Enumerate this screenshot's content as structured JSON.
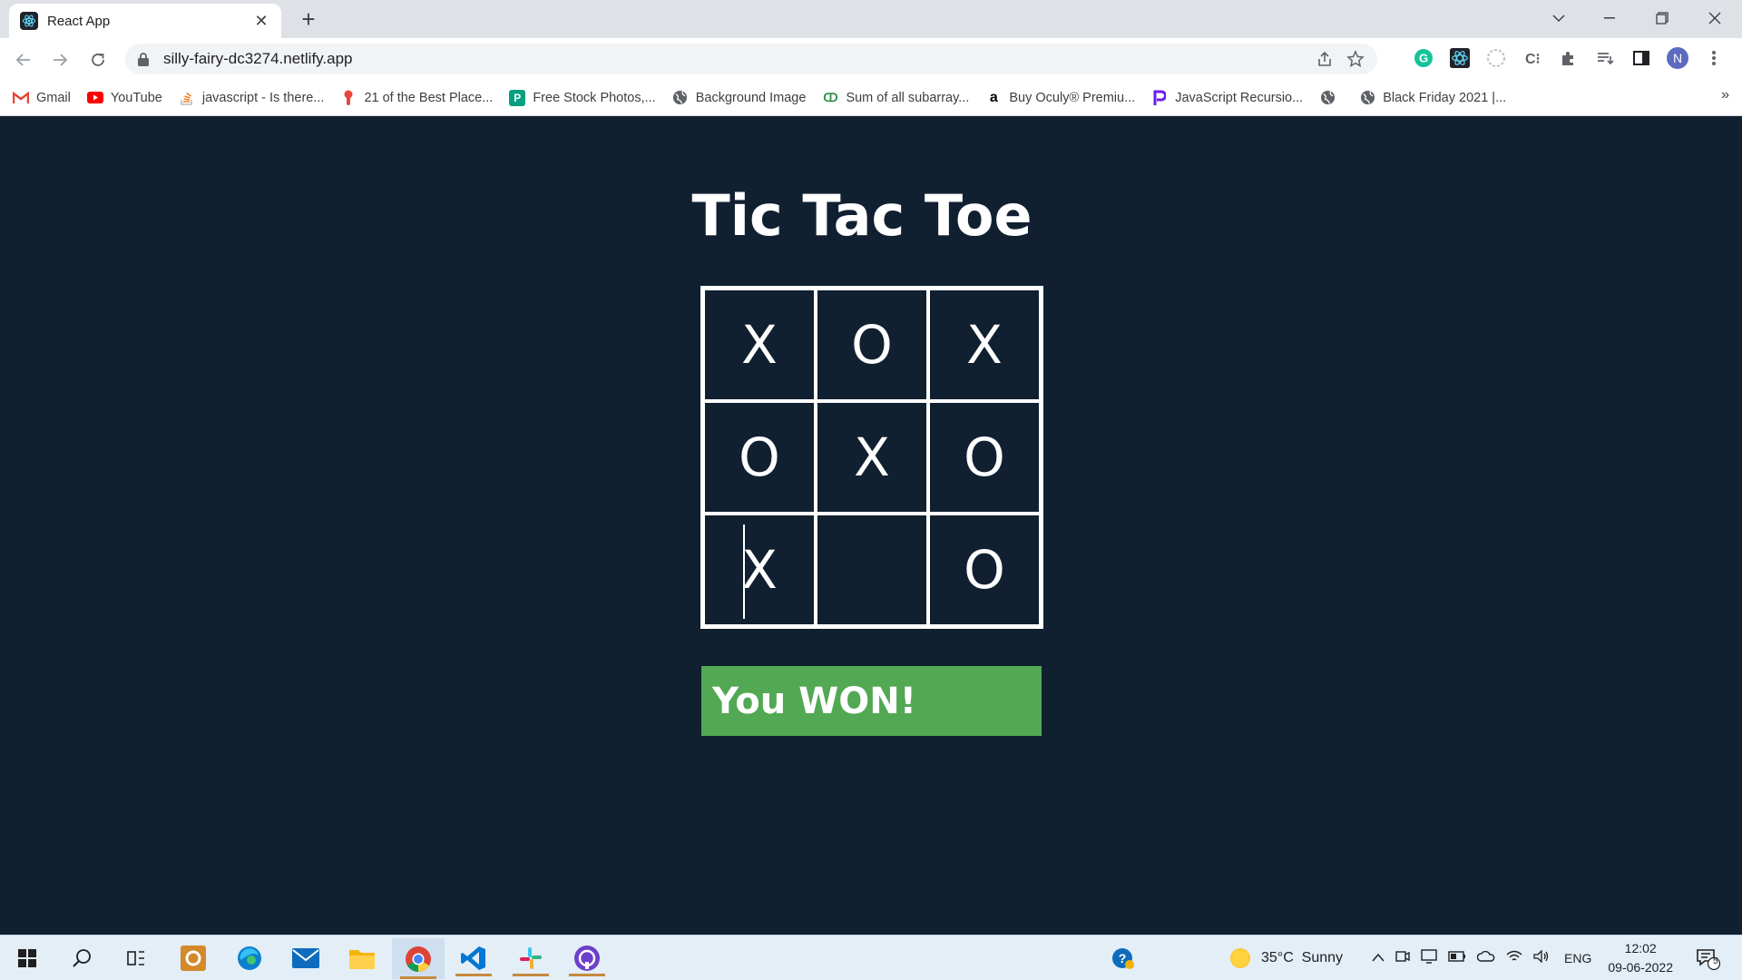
{
  "browser": {
    "tab_title": "React App",
    "url": "silly-fairy-dc3274.netlify.app",
    "profile_initial": "N",
    "bookmarks": [
      {
        "label": "Gmail",
        "icon": "gmail-icon",
        "color": "#ea4335"
      },
      {
        "label": "YouTube",
        "icon": "youtube-icon",
        "color": "#ff0000"
      },
      {
        "label": "javascript - Is there...",
        "icon": "stackoverflow-icon",
        "color": "#f48024"
      },
      {
        "label": "21 of the Best Place...",
        "icon": "pin-icon",
        "color": "#e8453c"
      },
      {
        "label": "Free Stock Photos,...",
        "icon": "pexels-icon",
        "color": "#05a081"
      },
      {
        "label": "Background Image",
        "icon": "globe-icon",
        "color": "#5f6368"
      },
      {
        "label": "Sum of all subarray...",
        "icon": "gfg-icon",
        "color": "#2f8d46"
      },
      {
        "label": "Buy Oculy® Premiu...",
        "icon": "amazon-icon",
        "color": "#000000"
      },
      {
        "label": "JavaScript Recursio...",
        "icon": "programiz-icon",
        "color": "#6a1bf5"
      },
      {
        "label": "",
        "icon": "globe-icon",
        "color": "#5f6368"
      },
      {
        "label": "Black Friday 2021 |...",
        "icon": "globe-icon",
        "color": "#5f6368"
      }
    ]
  },
  "game": {
    "title": "Tic Tac Toe",
    "cells": [
      "X",
      "O",
      "X",
      "O",
      "X",
      "O",
      "X",
      "",
      "O"
    ],
    "status": "You WON!"
  },
  "colors": {
    "page_bg": "#112031",
    "status_bg": "#52a853"
  },
  "taskbar": {
    "weather": "35°C  Sunny",
    "language": "ENG",
    "time": "12:02",
    "date": "09-06-2022",
    "notification_count": "5"
  }
}
